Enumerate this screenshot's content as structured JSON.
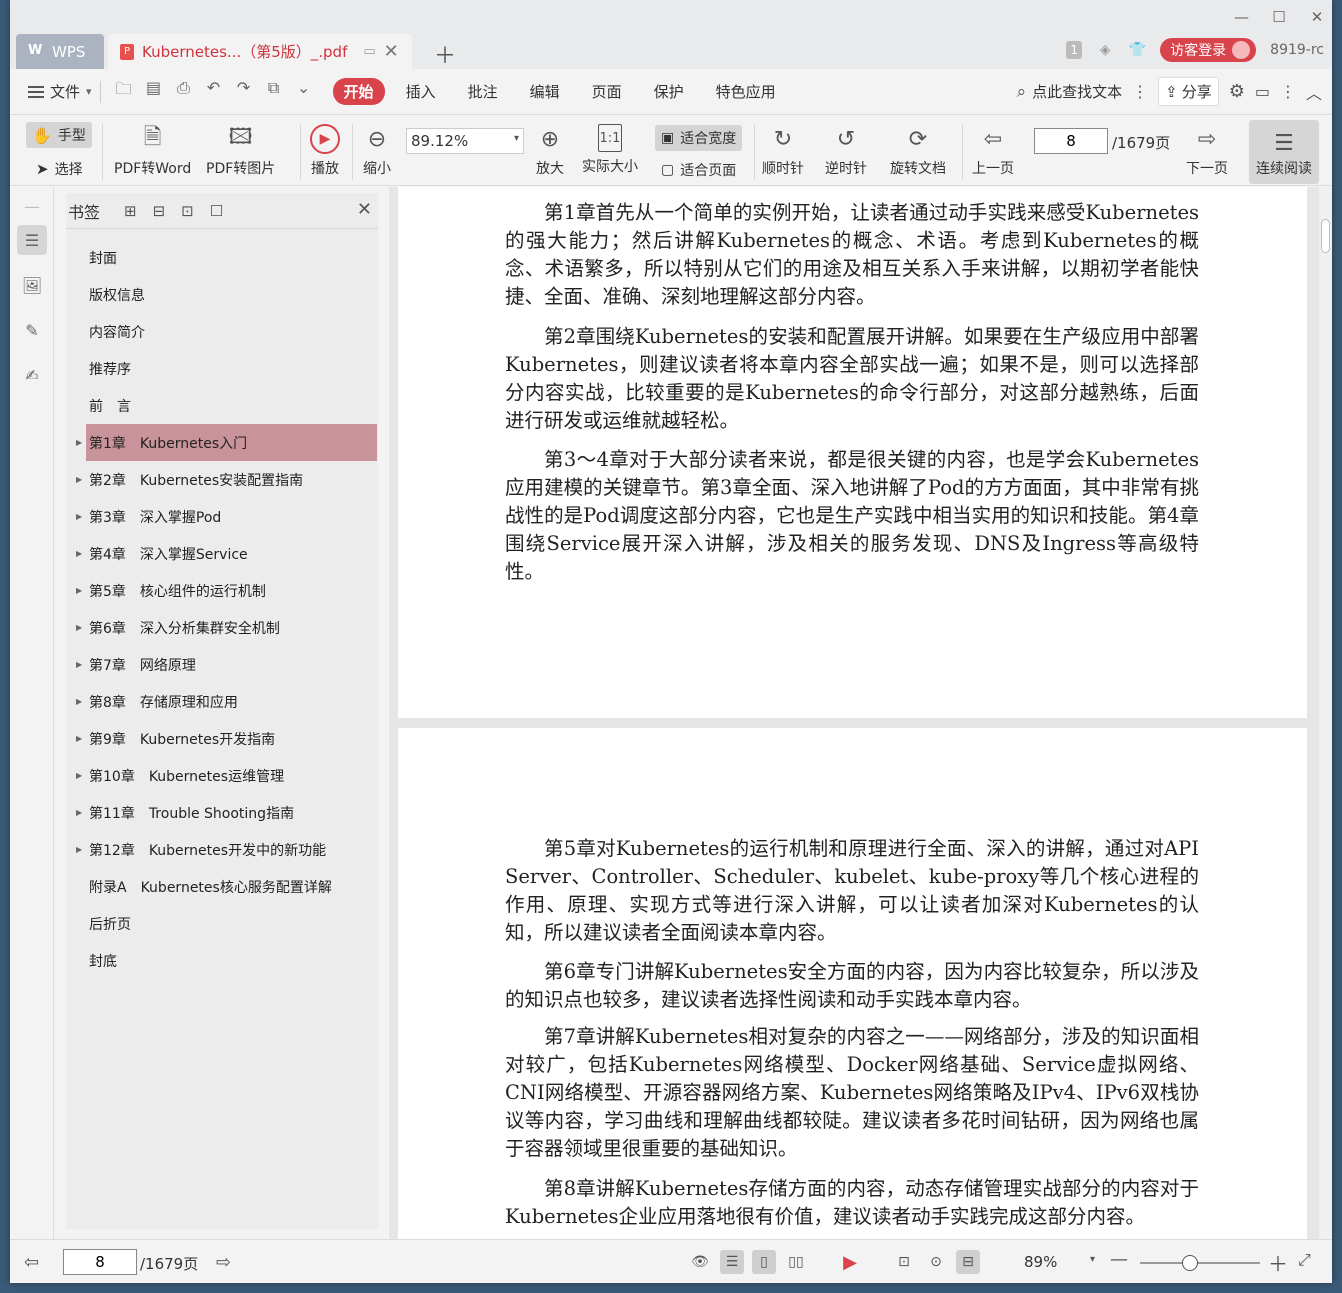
{
  "titlebar": {
    "app_tab": "WPS",
    "doc_tab": "Kubernetes...（第5版）_.pdf",
    "badge": "1",
    "login": "访客登录",
    "version": "8919-rc"
  },
  "menubar": {
    "file": "文件",
    "tabs": [
      "开始",
      "插入",
      "批注",
      "编辑",
      "页面",
      "保护",
      "特色应用"
    ],
    "search": "点此查找文本",
    "share": "分享"
  },
  "toolbar": {
    "hand": "手型",
    "select": "选择",
    "pdf_to_word": "PDF转Word",
    "pdf_to_image": "PDF转图片",
    "play": "播放",
    "zoom_out": "缩小",
    "zoom_value": "89.12%",
    "zoom_in": "放大",
    "actual_size": "实际大小",
    "fit_width": "适合宽度",
    "fit_page": "适合页面",
    "clockwise": "顺时针",
    "counter_clockwise": "逆时针",
    "rotate_doc": "旋转文档",
    "prev_page": "上一页",
    "page_number": "8",
    "page_total": "/1679页",
    "next_page": "下一页",
    "continuous": "连续阅读"
  },
  "bookmarks": {
    "title": "书签",
    "items": [
      {
        "label": "封面",
        "expandable": false
      },
      {
        "label": "版权信息",
        "expandable": false
      },
      {
        "label": "内容简介",
        "expandable": false
      },
      {
        "label": "推荐序",
        "expandable": false
      },
      {
        "label": "前　言",
        "expandable": false
      },
      {
        "label": "第1章　Kubernetes入门",
        "expandable": true
      },
      {
        "label": "第2章　Kubernetes安装配置指南",
        "expandable": true
      },
      {
        "label": "第3章　深入掌握Pod",
        "expandable": true
      },
      {
        "label": "第4章　深入掌握Service",
        "expandable": true
      },
      {
        "label": "第5章　核心组件的运行机制",
        "expandable": true
      },
      {
        "label": "第6章　深入分析集群安全机制",
        "expandable": true
      },
      {
        "label": "第7章　网络原理",
        "expandable": true
      },
      {
        "label": "第8章　存储原理和应用",
        "expandable": true
      },
      {
        "label": "第9章　Kubernetes开发指南",
        "expandable": true
      },
      {
        "label": "第10章　Kubernetes运维管理",
        "expandable": true
      },
      {
        "label": "第11章　Trouble Shooting指南",
        "expandable": true
      },
      {
        "label": "第12章　Kubernetes开发中的新功能",
        "expandable": true
      },
      {
        "label": "附录A　Kubernetes核心服务配置详解",
        "expandable": false
      },
      {
        "label": "后折页",
        "expandable": false
      },
      {
        "label": "封底",
        "expandable": false
      }
    ],
    "selected_index": 5
  },
  "document": {
    "page1": [
      "第1章首先从一个简单的实例开始，让读者通过动手实践来感受Kubernetes的强大能力；然后讲解Kubernetes的概念、术语。考虑到Kubernetes的概念、术语繁多，所以特别从它们的用途及相互关系入手来讲解，以期初学者能快捷、全面、准确、深刻地理解这部分内容。",
      "第2章围绕Kubernetes的安装和配置展开讲解。如果要在生产级应用中部署Kubernetes，则建议读者将本章内容全部实战一遍；如果不是，则可以选择部分内容实战，比较重要的是Kubernetes的命令行部分，对这部分越熟练，后面进行研发或运维就越轻松。",
      "第3～4章对于大部分读者来说，都是很关键的内容，也是学会Kubernetes应用建模的关键章节。第3章全面、深入地讲解了Pod的方方面面，其中非常有挑战性的是Pod调度这部分内容，它也是生产实践中相当实用的知识和技能。第4章围绕Service展开深入讲解，涉及相关的服务发现、DNS及Ingress等高级特性。"
    ],
    "page2": [
      "第5章对Kubernetes的运行机制和原理进行全面、深入的讲解，通过对API Server、Controller、Scheduler、kubelet、kube-proxy等几个核心进程的作用、原理、实现方式等进行深入讲解，可以让读者加深对Kubernetes的认知，所以建议读者全面阅读本章内容。",
      "第6章专门讲解Kubernetes安全方面的内容，因为内容比较复杂，所以涉及的知识点也较多，建议读者选择性阅读和动手实践本章内容。",
      "第7章讲解Kubernetes相对复杂的内容之一——网络部分，涉及的知识面相对较广，包括Kubernetes网络模型、Docker网络基础、Service虚拟网络、CNI网络模型、开源容器网络方案、Kubernetes网络策略及IPv4、IPv6双栈协议等内容，学习曲线和理解曲线都较陡。建议读者多花时间钻研，因为网络也属于容器领域里很重要的基础知识。",
      "第8章讲解Kubernetes存储方面的内容，动态存储管理实战部分的内容对于Kubernetes企业应用落地很有价值，建议读者动手实践完成这部分内容。"
    ]
  },
  "statusbar": {
    "page_number": "8",
    "page_total": "/1679页",
    "zoom": "89%"
  },
  "colors": {
    "accent": "#d9434b",
    "selected_bookmark": "#c9939b"
  }
}
